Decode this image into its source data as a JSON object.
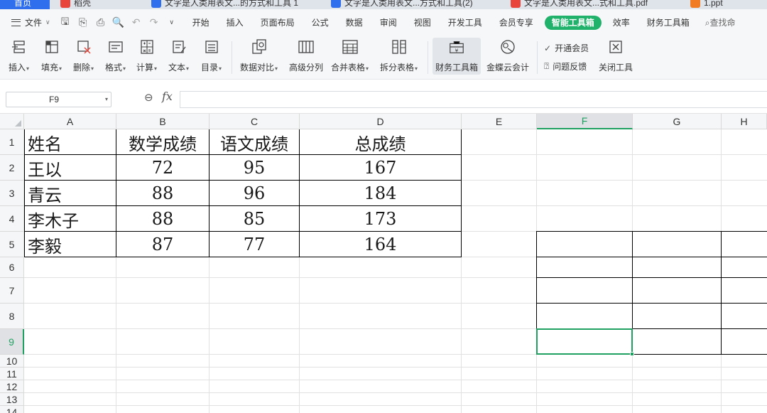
{
  "tabs": [
    {
      "label": "首页",
      "color": "#2f6fed"
    },
    {
      "label": "稻壳",
      "color": "#e8453c"
    },
    {
      "label": "文字是人类用表文...的方式和工具 1",
      "color": "#2f6fed"
    },
    {
      "label": "文字是人类用表文...方式和工具(2)",
      "color": "#2f6fed"
    },
    {
      "label": "文字是人类用表文...式和工具.pdf",
      "color": "#e8453c"
    },
    {
      "label": "1.ppt",
      "color": "#f07b22"
    }
  ],
  "menubar": {
    "file_label": "文件",
    "items": [
      "开始",
      "插入",
      "页面布局",
      "公式",
      "数据",
      "审阅",
      "视图",
      "开发工具",
      "会员专享",
      "智能工具箱",
      "效率",
      "财务工具箱"
    ],
    "active_item": "智能工具箱",
    "search_hint": "查找命"
  },
  "ribbon": {
    "buttons": [
      {
        "label": "插入",
        "icon": "insert-icon",
        "dropdown": true
      },
      {
        "label": "填充",
        "icon": "fill-icon",
        "dropdown": true
      },
      {
        "label": "删除",
        "icon": "delete-icon",
        "dropdown": true
      },
      {
        "label": "格式",
        "icon": "format-icon",
        "dropdown": true
      },
      {
        "label": "计算",
        "icon": "calculate-icon",
        "dropdown": true
      },
      {
        "label": "文本",
        "icon": "text-icon",
        "dropdown": true
      },
      {
        "label": "目录",
        "icon": "toc-icon",
        "dropdown": true
      },
      {
        "label": "数据对比",
        "icon": "data-compare-icon",
        "dropdown": true
      },
      {
        "label": "高级分列",
        "icon": "split-column-icon",
        "dropdown": false
      },
      {
        "label": "合并表格",
        "icon": "merge-table-icon",
        "dropdown": true
      },
      {
        "label": "拆分表格",
        "icon": "split-table-icon",
        "dropdown": true
      },
      {
        "label": "财务工具箱",
        "icon": "finance-toolbox-icon",
        "dropdown": false,
        "active": true
      },
      {
        "label": "金蝶云会计",
        "icon": "kingdee-icon",
        "dropdown": false
      }
    ],
    "small_buttons": [
      {
        "label": "开通会员",
        "icon": "check-circle-icon"
      },
      {
        "label": "问题反馈",
        "icon": "question-icon"
      },
      {
        "label": "关闭工具",
        "icon": "close-box-icon"
      }
    ]
  },
  "formula_bar": {
    "name_box": "F9",
    "fx_label": "fx",
    "formula": ""
  },
  "sheet": {
    "columns": [
      "A",
      "B",
      "C",
      "D",
      "E",
      "F",
      "G",
      "H"
    ],
    "rows": [
      "1",
      "2",
      "3",
      "4",
      "5",
      "6",
      "7",
      "8",
      "9",
      "10",
      "11",
      "12",
      "13",
      "14"
    ],
    "selected_cell": "F9",
    "table": {
      "headers": [
        "姓名",
        "数学成绩",
        "语文成绩",
        "总成绩"
      ],
      "rows": [
        [
          "王以",
          "72",
          "95",
          "167"
        ],
        [
          "青云",
          "88",
          "96",
          "184"
        ],
        [
          "李木子",
          "88",
          "85",
          "173"
        ],
        [
          "李毅",
          "87",
          "77",
          "164"
        ]
      ]
    }
  },
  "colors": {
    "accent_green": "#20a162",
    "active_menu_bg": "#20b26b",
    "home_tab_bg": "#2f6fed"
  }
}
